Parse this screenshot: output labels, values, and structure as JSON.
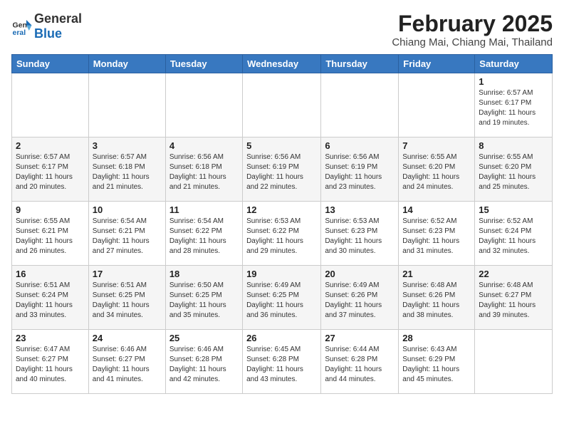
{
  "header": {
    "logo_general": "General",
    "logo_blue": "Blue",
    "title": "February 2025",
    "subtitle": "Chiang Mai, Chiang Mai, Thailand"
  },
  "days_of_week": [
    "Sunday",
    "Monday",
    "Tuesday",
    "Wednesday",
    "Thursday",
    "Friday",
    "Saturday"
  ],
  "weeks": [
    [
      {
        "day": "",
        "info": ""
      },
      {
        "day": "",
        "info": ""
      },
      {
        "day": "",
        "info": ""
      },
      {
        "day": "",
        "info": ""
      },
      {
        "day": "",
        "info": ""
      },
      {
        "day": "",
        "info": ""
      },
      {
        "day": "1",
        "info": "Sunrise: 6:57 AM\nSunset: 6:17 PM\nDaylight: 11 hours\nand 19 minutes."
      }
    ],
    [
      {
        "day": "2",
        "info": "Sunrise: 6:57 AM\nSunset: 6:17 PM\nDaylight: 11 hours\nand 20 minutes."
      },
      {
        "day": "3",
        "info": "Sunrise: 6:57 AM\nSunset: 6:18 PM\nDaylight: 11 hours\nand 21 minutes."
      },
      {
        "day": "4",
        "info": "Sunrise: 6:56 AM\nSunset: 6:18 PM\nDaylight: 11 hours\nand 21 minutes."
      },
      {
        "day": "5",
        "info": "Sunrise: 6:56 AM\nSunset: 6:19 PM\nDaylight: 11 hours\nand 22 minutes."
      },
      {
        "day": "6",
        "info": "Sunrise: 6:56 AM\nSunset: 6:19 PM\nDaylight: 11 hours\nand 23 minutes."
      },
      {
        "day": "7",
        "info": "Sunrise: 6:55 AM\nSunset: 6:20 PM\nDaylight: 11 hours\nand 24 minutes."
      },
      {
        "day": "8",
        "info": "Sunrise: 6:55 AM\nSunset: 6:20 PM\nDaylight: 11 hours\nand 25 minutes."
      }
    ],
    [
      {
        "day": "9",
        "info": "Sunrise: 6:55 AM\nSunset: 6:21 PM\nDaylight: 11 hours\nand 26 minutes."
      },
      {
        "day": "10",
        "info": "Sunrise: 6:54 AM\nSunset: 6:21 PM\nDaylight: 11 hours\nand 27 minutes."
      },
      {
        "day": "11",
        "info": "Sunrise: 6:54 AM\nSunset: 6:22 PM\nDaylight: 11 hours\nand 28 minutes."
      },
      {
        "day": "12",
        "info": "Sunrise: 6:53 AM\nSunset: 6:22 PM\nDaylight: 11 hours\nand 29 minutes."
      },
      {
        "day": "13",
        "info": "Sunrise: 6:53 AM\nSunset: 6:23 PM\nDaylight: 11 hours\nand 30 minutes."
      },
      {
        "day": "14",
        "info": "Sunrise: 6:52 AM\nSunset: 6:23 PM\nDaylight: 11 hours\nand 31 minutes."
      },
      {
        "day": "15",
        "info": "Sunrise: 6:52 AM\nSunset: 6:24 PM\nDaylight: 11 hours\nand 32 minutes."
      }
    ],
    [
      {
        "day": "16",
        "info": "Sunrise: 6:51 AM\nSunset: 6:24 PM\nDaylight: 11 hours\nand 33 minutes."
      },
      {
        "day": "17",
        "info": "Sunrise: 6:51 AM\nSunset: 6:25 PM\nDaylight: 11 hours\nand 34 minutes."
      },
      {
        "day": "18",
        "info": "Sunrise: 6:50 AM\nSunset: 6:25 PM\nDaylight: 11 hours\nand 35 minutes."
      },
      {
        "day": "19",
        "info": "Sunrise: 6:49 AM\nSunset: 6:25 PM\nDaylight: 11 hours\nand 36 minutes."
      },
      {
        "day": "20",
        "info": "Sunrise: 6:49 AM\nSunset: 6:26 PM\nDaylight: 11 hours\nand 37 minutes."
      },
      {
        "day": "21",
        "info": "Sunrise: 6:48 AM\nSunset: 6:26 PM\nDaylight: 11 hours\nand 38 minutes."
      },
      {
        "day": "22",
        "info": "Sunrise: 6:48 AM\nSunset: 6:27 PM\nDaylight: 11 hours\nand 39 minutes."
      }
    ],
    [
      {
        "day": "23",
        "info": "Sunrise: 6:47 AM\nSunset: 6:27 PM\nDaylight: 11 hours\nand 40 minutes."
      },
      {
        "day": "24",
        "info": "Sunrise: 6:46 AM\nSunset: 6:27 PM\nDaylight: 11 hours\nand 41 minutes."
      },
      {
        "day": "25",
        "info": "Sunrise: 6:46 AM\nSunset: 6:28 PM\nDaylight: 11 hours\nand 42 minutes."
      },
      {
        "day": "26",
        "info": "Sunrise: 6:45 AM\nSunset: 6:28 PM\nDaylight: 11 hours\nand 43 minutes."
      },
      {
        "day": "27",
        "info": "Sunrise: 6:44 AM\nSunset: 6:28 PM\nDaylight: 11 hours\nand 44 minutes."
      },
      {
        "day": "28",
        "info": "Sunrise: 6:43 AM\nSunset: 6:29 PM\nDaylight: 11 hours\nand 45 minutes."
      },
      {
        "day": "",
        "info": ""
      }
    ]
  ]
}
